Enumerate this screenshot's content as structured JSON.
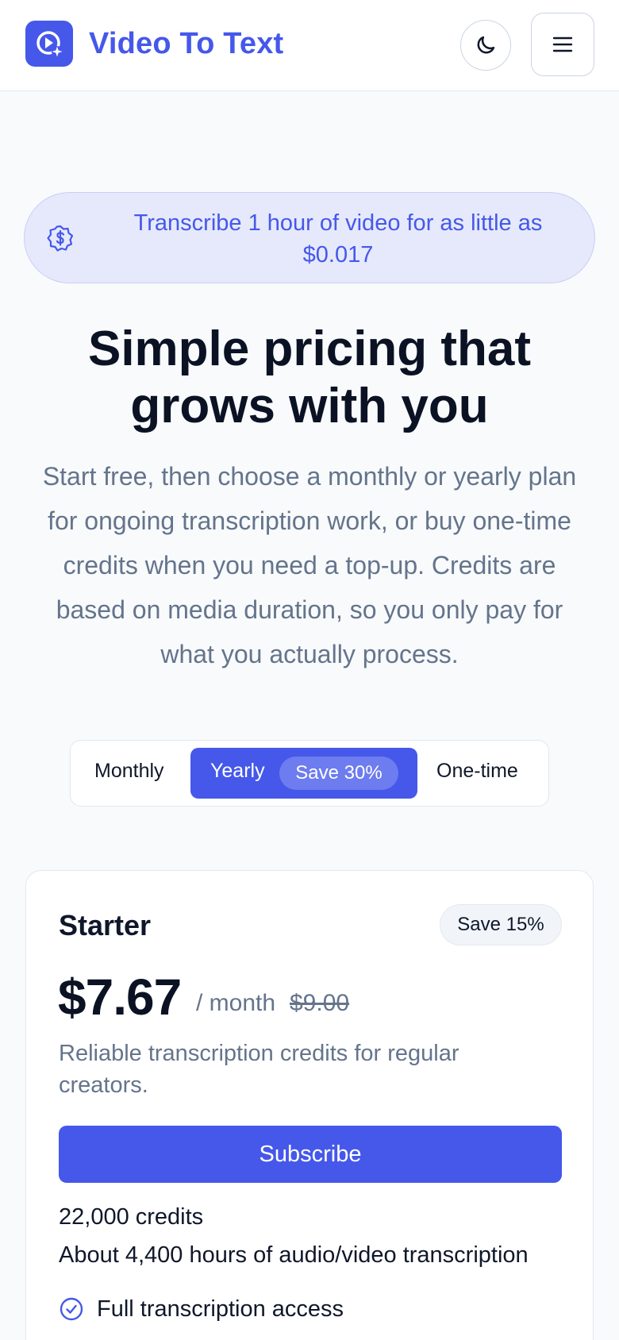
{
  "header": {
    "app_name": "Video To Text",
    "logo_icon": "play-sparkle-icon",
    "theme_icon": "moon-icon",
    "menu_icon": "hamburger-menu-icon"
  },
  "promo": {
    "icon": "dollar-badge-icon",
    "text": "Transcribe 1 hour of video for as little as $0.017"
  },
  "hero": {
    "title": "Simple pricing that grows with you",
    "subtitle": "Start free, then choose a monthly or yearly plan for ongoing transcription work, or buy one-time credits when you need a top-up. Credits are based on media duration, so you only pay for what you actually process."
  },
  "billing_toggle": {
    "options": [
      "Monthly",
      "Yearly",
      "One-time"
    ],
    "selected": "Yearly",
    "yearly_badge": "Save 30%"
  },
  "plan": {
    "name": "Starter",
    "badge": "Save 15%",
    "price": "$7.67",
    "period": "/ month",
    "original_price": "$9.00",
    "description": "Reliable transcription credits for regular creators.",
    "cta": "Subscribe",
    "credits_amount": "22,000",
    "credits_unit": "credits",
    "hours": "About 4,400 hours of audio/video transcription",
    "features": [
      {
        "icon": "check-circle-icon",
        "label": "Full transcription access"
      }
    ]
  },
  "colors": {
    "accent": "#4558ea",
    "promo_bg": "#e6e9fb",
    "text_primary": "#0f172a",
    "text_muted": "#64748b",
    "page_bg": "#f8fafc"
  }
}
